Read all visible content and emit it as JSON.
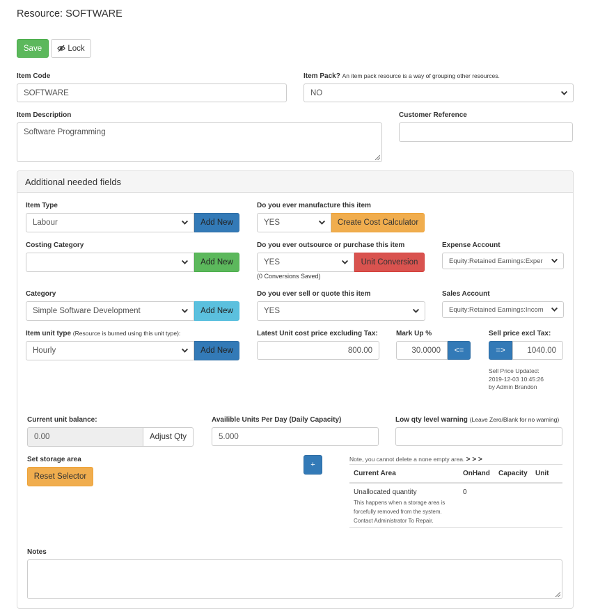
{
  "page": {
    "title": "Resource: SOFTWARE"
  },
  "toolbar": {
    "save_label": "Save",
    "lock_label": "Lock"
  },
  "form": {
    "item_code": {
      "label": "Item Code",
      "value": "SOFTWARE"
    },
    "item_pack": {
      "label": "Item Pack?",
      "note": "An item pack resource is a way of grouping other resources.",
      "value": "NO"
    },
    "item_description": {
      "label": "Item Description",
      "value": "Software Programming"
    },
    "customer_reference": {
      "label": "Customer Reference",
      "value": ""
    }
  },
  "panel": {
    "title": "Additional needed fields",
    "item_type": {
      "label": "Item Type",
      "value": "Labour",
      "add_label": "Add New"
    },
    "manufacture": {
      "label": "Do you ever manufacture this item",
      "value": "YES",
      "button_label": "Create Cost Calculator"
    },
    "costing_category": {
      "label": "Costing Category",
      "value": "",
      "add_label": "Add New"
    },
    "outsource": {
      "label": "Do you ever outsource or purchase this item",
      "value": "YES",
      "button_label": "Unit Conversion",
      "conversions_note": "(0 Conversions Saved)"
    },
    "expense_account": {
      "label": "Expense Account",
      "value": "Equity:Retained Earnings:Exper"
    },
    "category": {
      "label": "Category",
      "value": "Simple Software Development",
      "add_label": "Add New"
    },
    "sell_quote": {
      "label": "Do you ever sell or quote this item",
      "value": "YES"
    },
    "sales_account": {
      "label": "Sales Account",
      "value": "Equity:Retained Earnings:Incom"
    },
    "item_unit_type": {
      "label": "Item unit type",
      "note": "(Resource is burned using this unit type):",
      "value": "Hourly",
      "add_label": "Add New"
    },
    "latest_unit_cost": {
      "label": "Latest Unit cost price excluding Tax:",
      "value": "800.00"
    },
    "markup": {
      "label": "Mark Up %",
      "value": "30.0000",
      "button_label": "<="
    },
    "sell_price": {
      "label": "Sell price excl Tax:",
      "button_label": "=>",
      "value": "1040.00",
      "updated_line1": "Sell Price Updated:",
      "updated_line2": "2019-12-03 10:45:26",
      "updated_line3": "by Admin Brandon"
    },
    "current_unit_balance": {
      "label": "Current unit balance:",
      "value": "0.00",
      "button_label": "Adjust Qty"
    },
    "available_units": {
      "label": "Availible Units Per Day (Daily Capacity)",
      "value": "5.000"
    },
    "low_qty": {
      "label": "Low qty level warning",
      "note": "(Leave Zero/Blank for no warning)",
      "value": ""
    },
    "storage": {
      "label": "Set storage area",
      "reset_label": "Reset Selector",
      "add_label": "+",
      "note": "Note, you cannot delete a none empty area.",
      "arrows": "> > >",
      "columns": [
        "Current Area",
        "OnHand",
        "Capacity",
        "Unit"
      ],
      "rows": [
        {
          "area": "Unallocated quantity",
          "desc_1": "This happens when a storage area is",
          "desc_2": "forcefully removed from the system.",
          "desc_3": "Contact Administrator To Repair.",
          "onhand": "0",
          "capacity": "",
          "unit": ""
        }
      ]
    },
    "notes": {
      "label": "Notes",
      "value": ""
    }
  },
  "colors": {
    "success": "#5cb85c",
    "primary": "#337ab7",
    "info": "#5bc0de",
    "warning": "#f0ad4e",
    "danger": "#d9534f"
  },
  "icons": {
    "lock": "eye-slash-icon",
    "select_caret": "chevron-down-icon",
    "resize": "resize-grip-icon"
  }
}
